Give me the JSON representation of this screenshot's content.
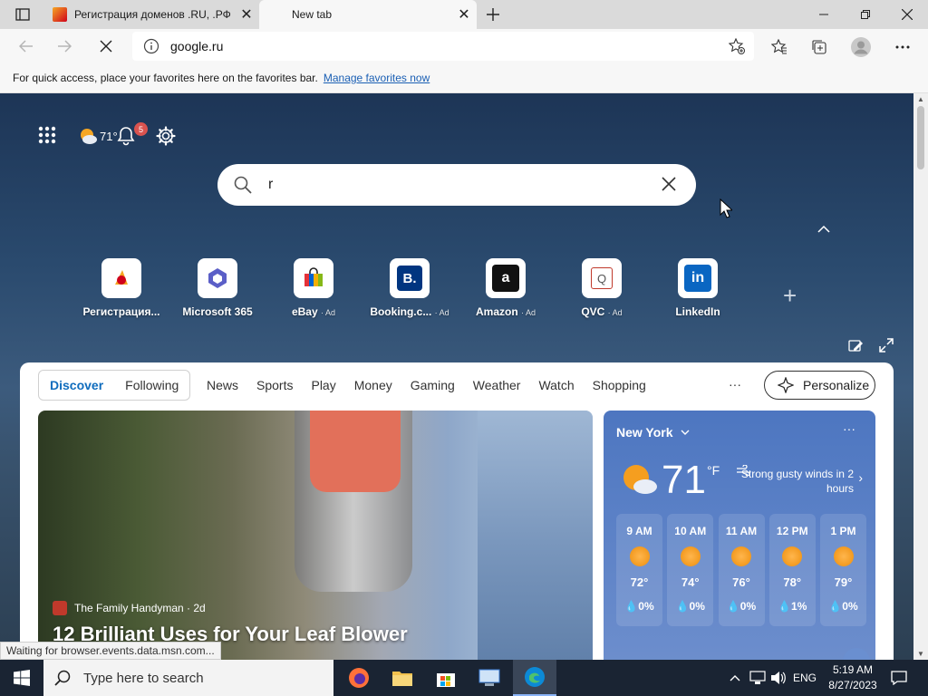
{
  "browser": {
    "tabs": [
      {
        "title": "Регистрация доменов .RU, .РФ у",
        "active": false
      },
      {
        "title": "New tab",
        "active": true
      }
    ],
    "address": "google.ru",
    "favorites_bar": {
      "text": "For quick access, place your favorites here on the favorites bar.",
      "link": "Manage favorites now"
    }
  },
  "ntp": {
    "weather_mini": {
      "temp": "71°",
      "badge_count": "5"
    },
    "search": {
      "value": "r"
    },
    "tiles": [
      {
        "label": "Регистрация...",
        "ad": ""
      },
      {
        "label": "Microsoft 365",
        "ad": ""
      },
      {
        "label": "eBay",
        "ad": "· Ad"
      },
      {
        "label": "Booking.c...",
        "ad": "· Ad"
      },
      {
        "label": "Amazon",
        "ad": "· Ad"
      },
      {
        "label": "QVC",
        "ad": "· Ad"
      },
      {
        "label": "LinkedIn",
        "ad": ""
      }
    ]
  },
  "feed": {
    "pivots": [
      "Discover",
      "Following"
    ],
    "tabs": [
      "News",
      "Sports",
      "Play",
      "Money",
      "Gaming",
      "Weather",
      "Watch",
      "Shopping"
    ],
    "more": "···",
    "personalize": "Personalize",
    "hero": {
      "source": "The Family Handyman · 2d",
      "headline": "12 Brilliant Uses for Your Leaf Blower"
    },
    "weather": {
      "location": "New York",
      "temp": "71",
      "unit": "°F",
      "alert": "Strong gusty winds in 2 hours",
      "hours": [
        {
          "time": "9 AM",
          "temp": "72°",
          "precip": "💧0%"
        },
        {
          "time": "10 AM",
          "temp": "74°",
          "precip": "💧0%"
        },
        {
          "time": "11 AM",
          "temp": "76°",
          "precip": "💧0%"
        },
        {
          "time": "12 PM",
          "temp": "78°",
          "precip": "💧1%"
        },
        {
          "time": "1 PM",
          "temp": "79°",
          "precip": "💧0%"
        }
      ]
    }
  },
  "status": "Waiting for browser.events.data.msn.com...",
  "taskbar": {
    "search_placeholder": "Type here to search",
    "lang": "ENG",
    "time": "5:19 AM",
    "date": "8/27/2023"
  }
}
